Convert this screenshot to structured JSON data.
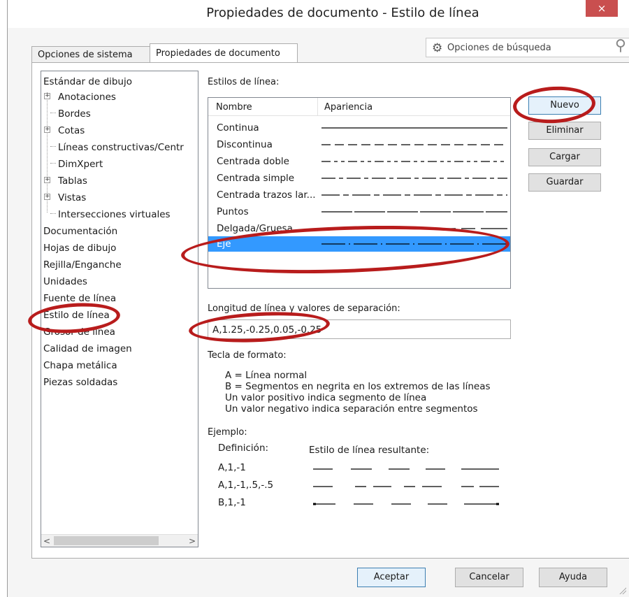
{
  "window": {
    "title": "Propiedades de documento - Estilo de línea",
    "close_label": "×"
  },
  "search": {
    "placeholder": "Opciones de búsqueda",
    "gear_icon": "gear-icon",
    "magnifier_icon": "search-icon"
  },
  "tabs": [
    {
      "label": "Opciones de sistema",
      "active": false
    },
    {
      "label": "Propiedades de documento",
      "active": true
    }
  ],
  "tree": {
    "items": [
      {
        "label": "Estándar de dibujo",
        "level": 0,
        "expandable": false
      },
      {
        "label": "Anotaciones",
        "level": 1,
        "expandable": true
      },
      {
        "label": "Bordes",
        "level": 1,
        "expandable": false
      },
      {
        "label": "Cotas",
        "level": 1,
        "expandable": true
      },
      {
        "label": "Líneas constructivas/Centr",
        "level": 1,
        "expandable": false
      },
      {
        "label": "DimXpert",
        "level": 1,
        "expandable": false
      },
      {
        "label": "Tablas",
        "level": 1,
        "expandable": true
      },
      {
        "label": "Vistas",
        "level": 1,
        "expandable": true
      },
      {
        "label": "Intersecciones virtuales",
        "level": 1,
        "expandable": false
      },
      {
        "label": "Documentación",
        "level": 0,
        "expandable": false
      },
      {
        "label": "Hojas de dibujo",
        "level": 0,
        "expandable": false
      },
      {
        "label": "Rejilla/Enganche",
        "level": 0,
        "expandable": false
      },
      {
        "label": "Unidades",
        "level": 0,
        "expandable": false
      },
      {
        "label": "Fuente de línea",
        "level": 0,
        "expandable": false
      },
      {
        "label": "Estilo de línea",
        "level": 0,
        "expandable": false
      },
      {
        "label": "Grosor de línea",
        "level": 0,
        "expandable": false
      },
      {
        "label": "Calidad de imagen",
        "level": 0,
        "expandable": false
      },
      {
        "label": "Chapa metálica",
        "level": 0,
        "expandable": false
      },
      {
        "label": "Piezas soldadas",
        "level": 0,
        "expandable": false
      }
    ],
    "scroll_left": "<",
    "scroll_right": ">"
  },
  "styles": {
    "label": "Estilos de línea:",
    "col_name": "Nombre",
    "col_appearance": "Apariencia",
    "rows": [
      {
        "name": "Continua",
        "pattern": "continuous"
      },
      {
        "name": "Discontinua",
        "pattern": "dashed"
      },
      {
        "name": "Centrada doble",
        "pattern": "center-double"
      },
      {
        "name": "Centrada simple",
        "pattern": "center-single"
      },
      {
        "name": "Centrada trazos lar...",
        "pattern": "center-long"
      },
      {
        "name": "Puntos",
        "pattern": "dots"
      },
      {
        "name": "Delgada/Gruesa",
        "pattern": "thin-thick"
      },
      {
        "name": "Eje",
        "pattern": "axis",
        "selected": true
      }
    ]
  },
  "buttons": {
    "new": "Nuevo",
    "delete": "Eliminar",
    "load": "Cargar",
    "save": "Guardar"
  },
  "length": {
    "label": "Longitud de línea y valores de separación:",
    "value": "A,1.25,-0.25,0.05,-0.25"
  },
  "format_key": {
    "label": "Tecla de formato:",
    "lines": [
      "A = Línea normal",
      "B = Segmentos en negrita en los extremos de las líneas",
      "Un valor positivo indica segmento de línea",
      "Un valor negativo indica separación entre segmentos"
    ]
  },
  "example": {
    "label": "Ejemplo:",
    "col_definition": "Definición:",
    "col_result": "Estilo de línea resultante:",
    "rows": [
      "A,1,-1",
      "A,1,-1,.5,-.5",
      "B,1,-1"
    ]
  },
  "footer": {
    "ok": "Aceptar",
    "cancel": "Cancelar",
    "help": "Ayuda"
  },
  "colors": {
    "selection": "#3399ff",
    "annotation": "#b81c1c",
    "close": "#c94f4f"
  }
}
